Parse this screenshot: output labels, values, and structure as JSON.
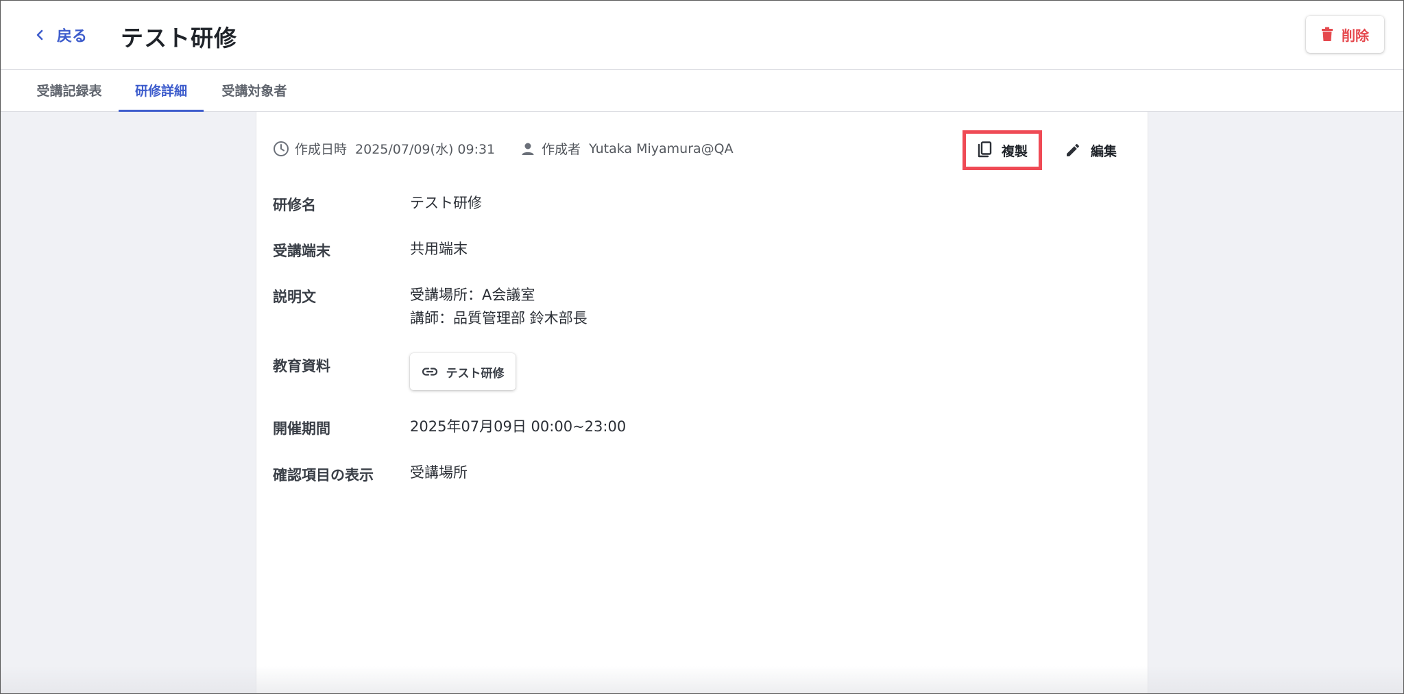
{
  "header": {
    "back_label": "戻る",
    "title": "テスト研修",
    "delete_label": "削除"
  },
  "tabs": [
    {
      "label": "受講記録表"
    },
    {
      "label": "研修詳細",
      "active": true
    },
    {
      "label": "受講対象者"
    }
  ],
  "meta": {
    "created_at_label": "作成日時",
    "created_at": "2025/07/09(水) 09:31",
    "author_label": "作成者",
    "author": "Yutaka Miyamura@QA"
  },
  "actions": {
    "duplicate_label": "複製",
    "edit_label": "編集"
  },
  "fields": {
    "name": {
      "label": "研修名",
      "value": "テスト研修"
    },
    "device": {
      "label": "受講端末",
      "value": "共用端末"
    },
    "description": {
      "label": "説明文",
      "lines": [
        "受講場所：A会議室",
        "講師：品質管理部 鈴木部長"
      ]
    },
    "materials": {
      "label": "教育資料",
      "items": [
        "テスト研修"
      ]
    },
    "period": {
      "label": "開催期間",
      "value": "2025年07月09日 00:00~23:00"
    },
    "confirmation": {
      "label": "確認項目の表示",
      "value": "受講場所"
    }
  },
  "colors": {
    "accent": "#3d5ccc",
    "danger": "#e5484d",
    "highlight": "#ef4a55",
    "background": "#f0f1f5"
  },
  "icons": {
    "back": "chevron-left-icon",
    "delete": "trash-icon",
    "clock": "clock-icon",
    "person": "person-icon",
    "duplicate": "copy-icon",
    "edit": "pencil-icon",
    "link": "link-icon"
  }
}
